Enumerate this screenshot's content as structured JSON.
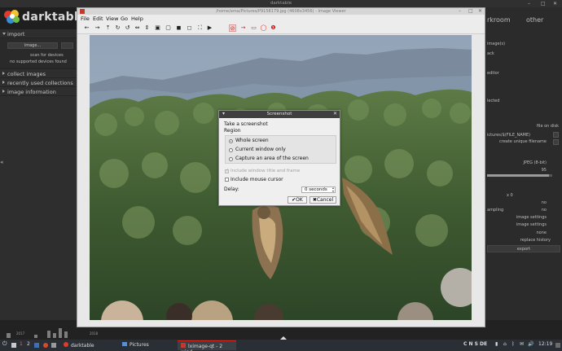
{
  "darktable": {
    "window_title": "darktable",
    "brand": "darktable",
    "left_panel": {
      "import_label": "import",
      "image_button": "image...",
      "scan_button": "scan for devices",
      "no_devices": "no supported devices found",
      "collect_images": "collect images",
      "recently_used": "recently used collections",
      "image_information": "image information"
    },
    "right_panel": {
      "mode_darkroom": "rkroom",
      "mode_other": "other",
      "rows": [
        "image(s)",
        "ack",
        "editor",
        "lected"
      ],
      "file_on_disk": "file on disk",
      "path_pattern": "ictures/$(FILE_NAME)",
      "on_conflict": "create unique filename",
      "format": "JPEG (8-bit)",
      "quality": "95",
      "size_x": "x 0",
      "upscale": "no",
      "sampling_label": "ampling",
      "sampling_value": "no",
      "profile": "image settings",
      "intent": "image settings",
      "style": "none",
      "mode": "replace history",
      "export_button": "export"
    },
    "filmstrip": {
      "label_left": "2017",
      "label_right": "2018"
    }
  },
  "viewer": {
    "title": "/home/ama/Pictures/P9158179.jpg (4608x3456) - Image Viewer",
    "menu": [
      "File",
      "Edit",
      "View",
      "Go",
      "Help"
    ]
  },
  "dialog": {
    "title": "Screenshot",
    "heading": "Take a screenshot",
    "region_label": "Region",
    "options": [
      "Whole screen",
      "Current window only",
      "Capture an area of the screen"
    ],
    "selected_index": 0,
    "include_frame": "Include window title and frame",
    "include_cursor": "Include mouse cursor",
    "delay_label": "Delay:",
    "delay_value": "0 seconds",
    "ok": "✔OK",
    "cancel": "✖Cancel"
  },
  "taskbar": {
    "workspaces": [
      "1",
      "2"
    ],
    "tasks": [
      "darktable",
      "Pictures",
      "lximage-qt - 2 wind..."
    ],
    "tray": "C N S DE",
    "clock": "12:19"
  }
}
